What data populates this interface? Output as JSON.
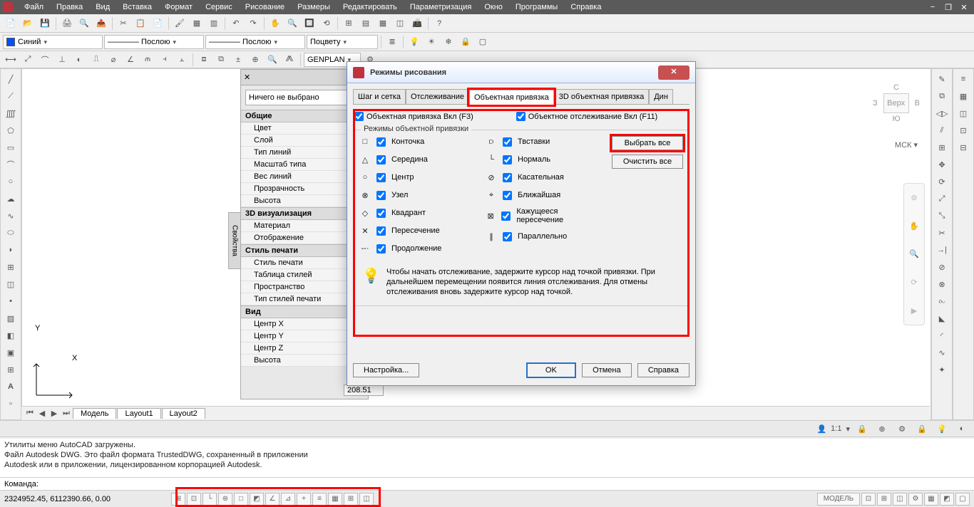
{
  "menu": {
    "items": [
      "Файл",
      "Правка",
      "Вид",
      "Вставка",
      "Формат",
      "Сервис",
      "Рисование",
      "Размеры",
      "Редактировать",
      "Параметризация",
      "Окно",
      "Программы",
      "Справка"
    ]
  },
  "dropdowns": {
    "color_label": "Синий",
    "linetype_label": "———— Послою",
    "lineweight_label": "———— Послою",
    "plotstyle_label": "Поцвету",
    "genplan": "GENPLAN"
  },
  "props": {
    "nosel": "Ничего не выбрано",
    "sections": [
      {
        "title": "Общие",
        "rows": [
          "Цвет",
          "Слой",
          "Тип линий",
          "Масштаб типа",
          "Вес линий",
          "Прозрачность",
          "Высота"
        ]
      },
      {
        "title": "3D визуализация",
        "rows": [
          "Материал",
          "Отображение"
        ]
      },
      {
        "title": "Стиль печати",
        "rows": [
          "Стиль печати",
          "Таблица стилей",
          "Пространство",
          "Тип стилей печати"
        ]
      },
      {
        "title": "Вид",
        "rows": [
          "Центр X",
          "Центр Y",
          "Центр Z",
          "Высота"
        ]
      }
    ],
    "side_tab": "Свойства",
    "val208": "208.51"
  },
  "viewcube": {
    "n": "С",
    "s": "Ю",
    "w": "З",
    "e": "В",
    "face": "Верх",
    "mck": "МСК ▾"
  },
  "layout_tabs": [
    "Модель",
    "Layout1",
    "Layout2"
  ],
  "statuswide": {
    "scale": "1:1"
  },
  "cmdlog": [
    "Утилиты меню AutoCAD загружены.",
    "Файл Autodesk DWG. Это файл формата TrustedDWG, сохраненный в приложении",
    "Autodesk или в приложении, лицензированном корпорацией Autodesk."
  ],
  "cmdline_label": "Команда:",
  "coords": "2324952.45, 6112390.66, 0.00",
  "model_btn": "МОДЕЛЬ",
  "axes": {
    "x": "X",
    "y": "Y"
  },
  "dialog": {
    "title": "Режимы рисования",
    "tabs": [
      "Шаг и сетка",
      "Отслеживание",
      "Объектная привязка",
      "3D объектная привязка",
      "Дин"
    ],
    "osnap_on": "Объектная привязка Вкл (F3)",
    "otrack_on": "Объектное отслеживание Вкл (F11)",
    "group_legend": "Режимы объектной привязки",
    "snaps_left": [
      {
        "icon": "□",
        "label": "Конточка"
      },
      {
        "icon": "△",
        "label": "Середина"
      },
      {
        "icon": "○",
        "label": "Центр"
      },
      {
        "icon": "⊗",
        "label": "Узел"
      },
      {
        "icon": "◇",
        "label": "Квадрант"
      },
      {
        "icon": "✕",
        "label": "Пересечение"
      },
      {
        "icon": "--·",
        "label": "Продолжение"
      }
    ],
    "snaps_right": [
      {
        "icon": "⫐",
        "label": "Твставки"
      },
      {
        "icon": "└",
        "label": "Нормаль"
      },
      {
        "icon": "⊘",
        "label": "Касательная"
      },
      {
        "icon": "⌖",
        "label": "Ближайшая"
      },
      {
        "icon": "⊠",
        "label": "Кажущееся пересечение"
      },
      {
        "icon": "∥",
        "label": "Параллельно"
      }
    ],
    "select_all": "Выбрать все",
    "clear_all": "Очистить все",
    "tip": "Чтобы начать отслеживание, задержите курсор над точкой привязки. При дальнейшем перемещении появится линия отслеживания. Для отмены отслеживания вновь задержите курсор над точкой.",
    "settings": "Настройка...",
    "ok": "OK",
    "cancel": "Отмена",
    "help": "Справка"
  }
}
